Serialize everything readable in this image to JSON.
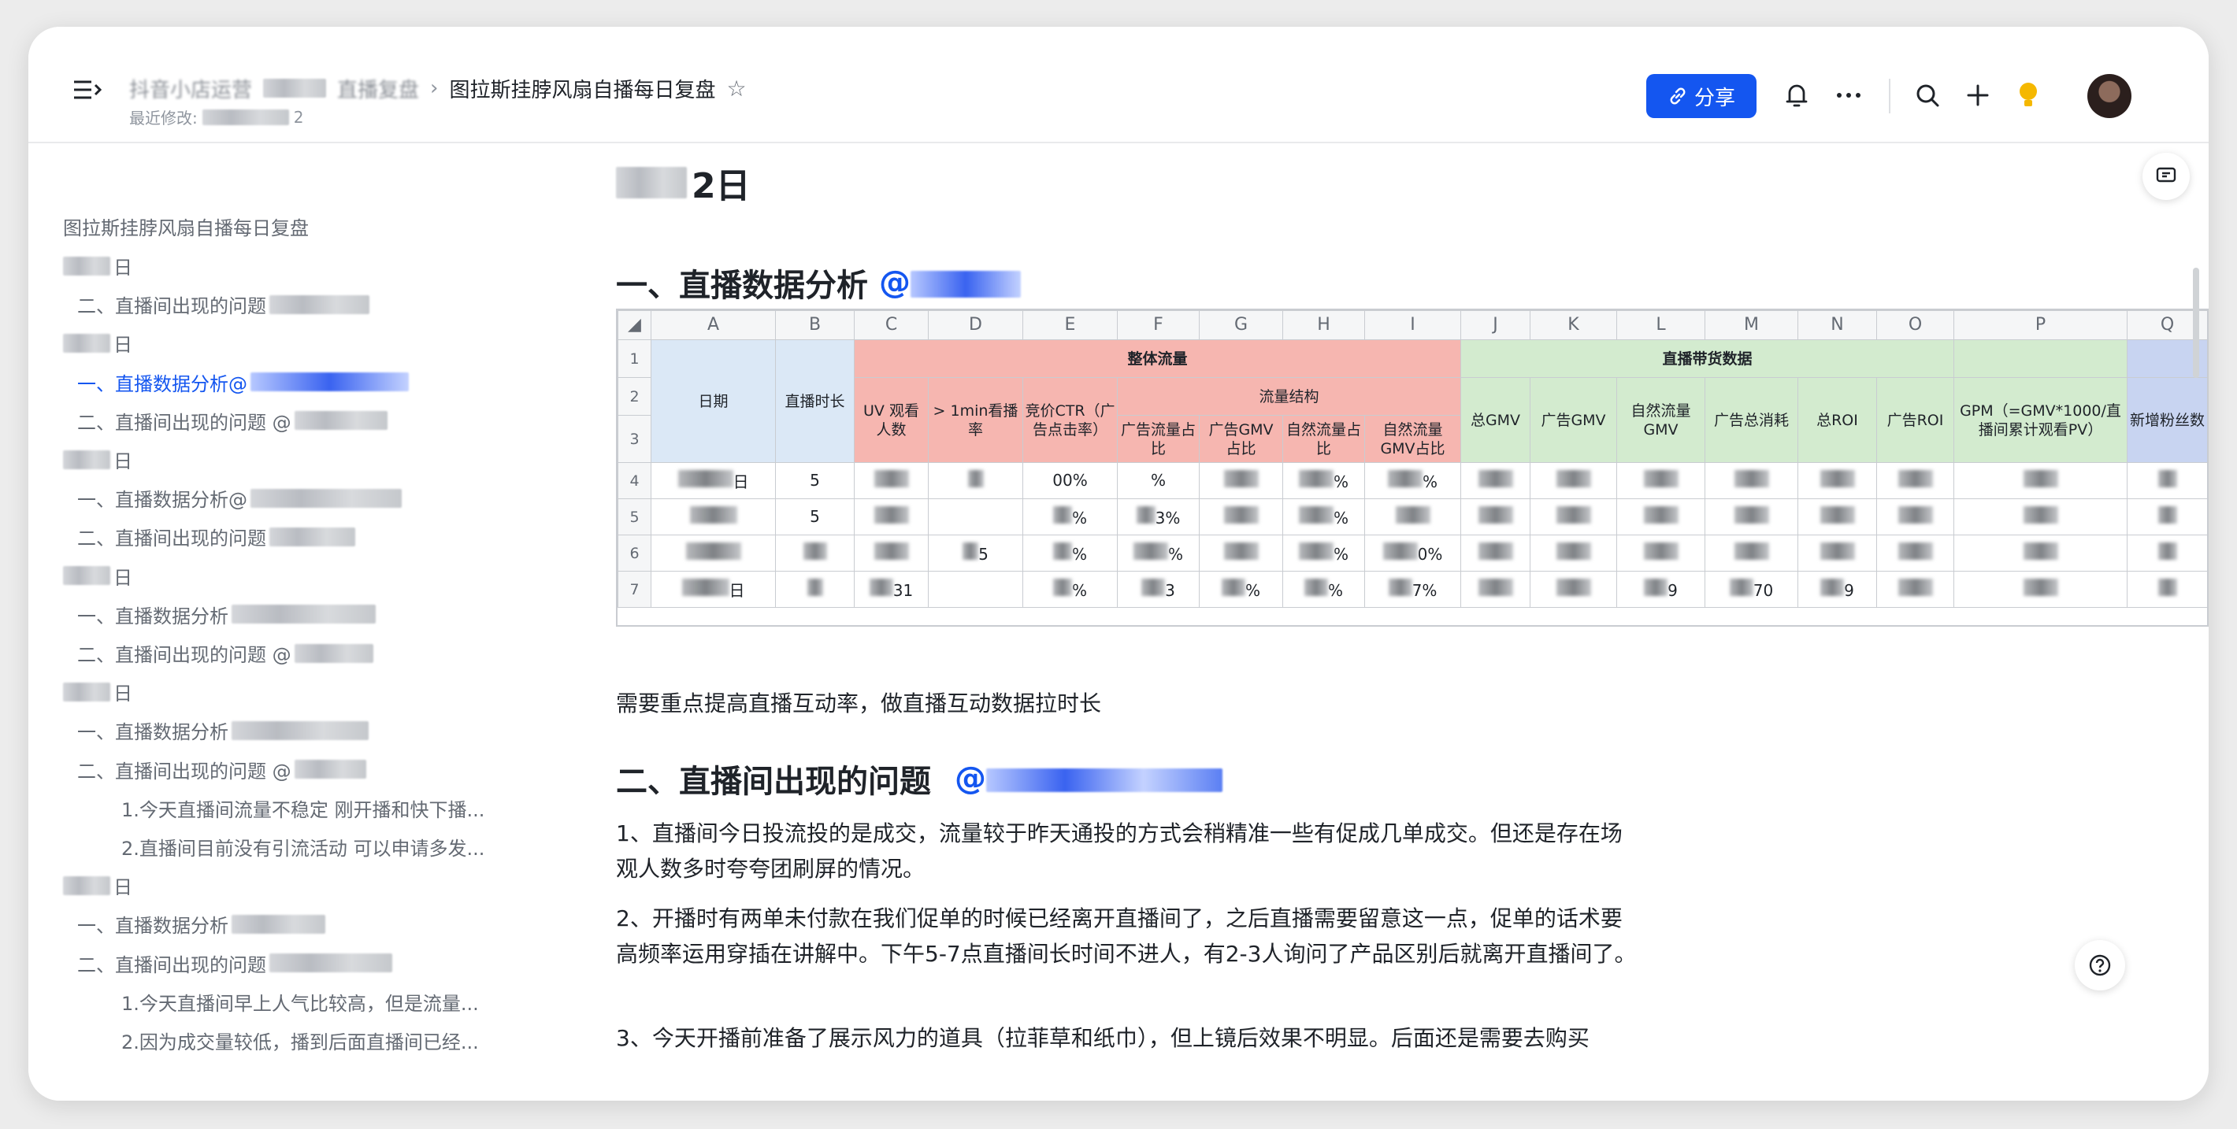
{
  "header": {
    "breadcrumb_root": "抖音小店运营",
    "breadcrumb_folder": "直播复盘",
    "doc_title": "图拉斯挂脖风扇自播每日复盘",
    "modified_label": "最近修改:",
    "modified_value": "2",
    "share_label": "分享"
  },
  "sidebar": {
    "title": "图拉斯挂脖风扇自播每日复盘",
    "items": [
      {
        "label": "日",
        "level": 0
      },
      {
        "label": "二、直播间出现的问题",
        "level": 1
      },
      {
        "label": "日",
        "level": 0
      },
      {
        "label": "一、直播数据分析@",
        "level": 1,
        "active": true
      },
      {
        "label": "二、直播间出现的问题 @",
        "level": 1
      },
      {
        "label": "日",
        "level": 0
      },
      {
        "label": "一、直播数据分析@",
        "level": 1
      },
      {
        "label": "二、直播间出现的问题",
        "level": 1
      },
      {
        "label": "日",
        "level": 0
      },
      {
        "label": "一、直播数据分析",
        "level": 1
      },
      {
        "label": "二、直播间出现的问题 @",
        "level": 1
      },
      {
        "label": "日",
        "level": 0
      },
      {
        "label": "一、直播数据分析",
        "level": 1
      },
      {
        "label": "二、直播间出现的问题 @",
        "level": 1
      },
      {
        "label": "1.今天直播间流量不稳定 刚开播和快下播...",
        "level": 2
      },
      {
        "label": "2.直播间目前没有引流活动 可以申请多发...",
        "level": 2
      },
      {
        "label": "日",
        "level": 0
      },
      {
        "label": "一、直播数据分析",
        "level": 1
      },
      {
        "label": "二、直播间出现的问题",
        "level": 1
      },
      {
        "label": "1.今天直播间早上人气比较高，但是流量...",
        "level": 2
      },
      {
        "label": "2.因为成交量较低，播到后面直播间已经...",
        "level": 2
      }
    ]
  },
  "content": {
    "date_heading": "2日",
    "section1": "一、直播数据分析",
    "section1_mention": "@",
    "sheet": {
      "col_letters": [
        "A",
        "B",
        "C",
        "D",
        "E",
        "F",
        "G",
        "H",
        "I",
        "J",
        "K",
        "L",
        "M",
        "N",
        "O",
        "P",
        "Q"
      ],
      "row_numbers": [
        "1",
        "2",
        "3",
        "4",
        "5",
        "6",
        "7"
      ],
      "h_date": "日期",
      "h_duration": "直播时长",
      "h_overall": "整体流量",
      "h_sales": "直播带货数据",
      "h_structure": "流量结构",
      "h_uv": "UV 观看人数",
      "h_1min": "> 1min看播率",
      "h_ctr": "竞价CTR（广告点击率）",
      "h_ad_flow": "广告流量占比",
      "h_ad_gmv_pct": "广告GMV占比",
      "h_nat_flow": "自然流量占比",
      "h_nat_gmv_pct": "自然流量GMV占比",
      "h_total_gmv": "总GMV",
      "h_ad_gmv": "广告GMV",
      "h_nat_gmv": "自然流量GMV",
      "h_ad_spend": "广告总消耗",
      "h_total_roi": "总ROI",
      "h_ad_roi": "广告ROI",
      "h_gpm": "GPM（=GMV*1000/直播间累计观看PV）",
      "h_new_fans": "新增粉丝数",
      "rows": [
        {
          "date": "日",
          "b": "5",
          "e": "00%",
          "f": "%",
          "h": "%",
          "i": "%"
        },
        {
          "date": "",
          "b": "5",
          "e": "%",
          "f": "3%",
          "h": "%",
          "i": ""
        },
        {
          "date": "",
          "b": "",
          "d": "5",
          "e": "%",
          "f": "%",
          "h": "%",
          "i": "0%"
        },
        {
          "date": "日",
          "b": "",
          "c": "31",
          "e": "%",
          "f": "3",
          "g": "%",
          "h": "%",
          "i": "7%",
          "l": "9",
          "m": "70",
          "n": "9"
        }
      ]
    },
    "note": "需要重点提高直播互动率，做直播互动数据拉时长",
    "section2": "二、直播间出现的问题",
    "section2_mention": "@",
    "p1": "1、直播间今日投流投的是成交，流量较于昨天通投的方式会稍精准一些有促成几单成交。但还是存在场观人数多时夸夸团刷屏的情况。",
    "p2": "2、开播时有两单未付款在我们促单的时候已经离开直播间了，之后直播需要留意这一点，促单的话术要高频率运用穿插在讲解中。下午5-7点直播间长时间不进人，有2-3人询问了产品区别后就离开直播间了。",
    "p3": "3、今天开播前准备了展示风力的道具（拉菲草和纸巾），但上镜后效果不明显。后面还是需要去购买"
  },
  "colors": {
    "accent": "#1456f0",
    "header_red": "#f6b6b0",
    "header_green": "#d3ebcf",
    "header_blue": "#dbe8f6"
  }
}
